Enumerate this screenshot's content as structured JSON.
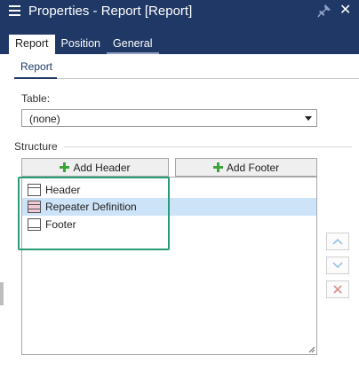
{
  "window": {
    "title": "Properties - Report [Report]",
    "menu_icon": "hamburger-icon",
    "pin_icon": "pin-icon",
    "close_icon": "close-icon",
    "close_glyph": "✕"
  },
  "tabs": [
    {
      "label": "Report",
      "active": true
    },
    {
      "label": "Position",
      "active": false
    },
    {
      "label": "General",
      "active": false
    }
  ],
  "subtab": {
    "label": "Report"
  },
  "table_field": {
    "label": "Table:",
    "value": "(none)"
  },
  "structure": {
    "label": "Structure",
    "add_header_label": "Add Header",
    "add_footer_label": "Add Footer",
    "items": [
      {
        "label": "Header",
        "icon": "header-band-icon",
        "selected": false
      },
      {
        "label": "Repeater Definition",
        "icon": "repeater-band-icon",
        "selected": true
      },
      {
        "label": "Footer",
        "icon": "footer-band-icon",
        "selected": false
      }
    ]
  },
  "side_buttons": {
    "up_icon": "chevron-up-icon",
    "down_icon": "chevron-down-icon",
    "remove_icon": "remove-x-icon"
  },
  "colors": {
    "titlebar": "#1f3866",
    "selection": "#cde3f7",
    "highlight": "#2a9d78",
    "add_icon": "#3aa63a",
    "remove_icon": "#e08a8a",
    "arrow_icon": "#9cc0e8"
  }
}
